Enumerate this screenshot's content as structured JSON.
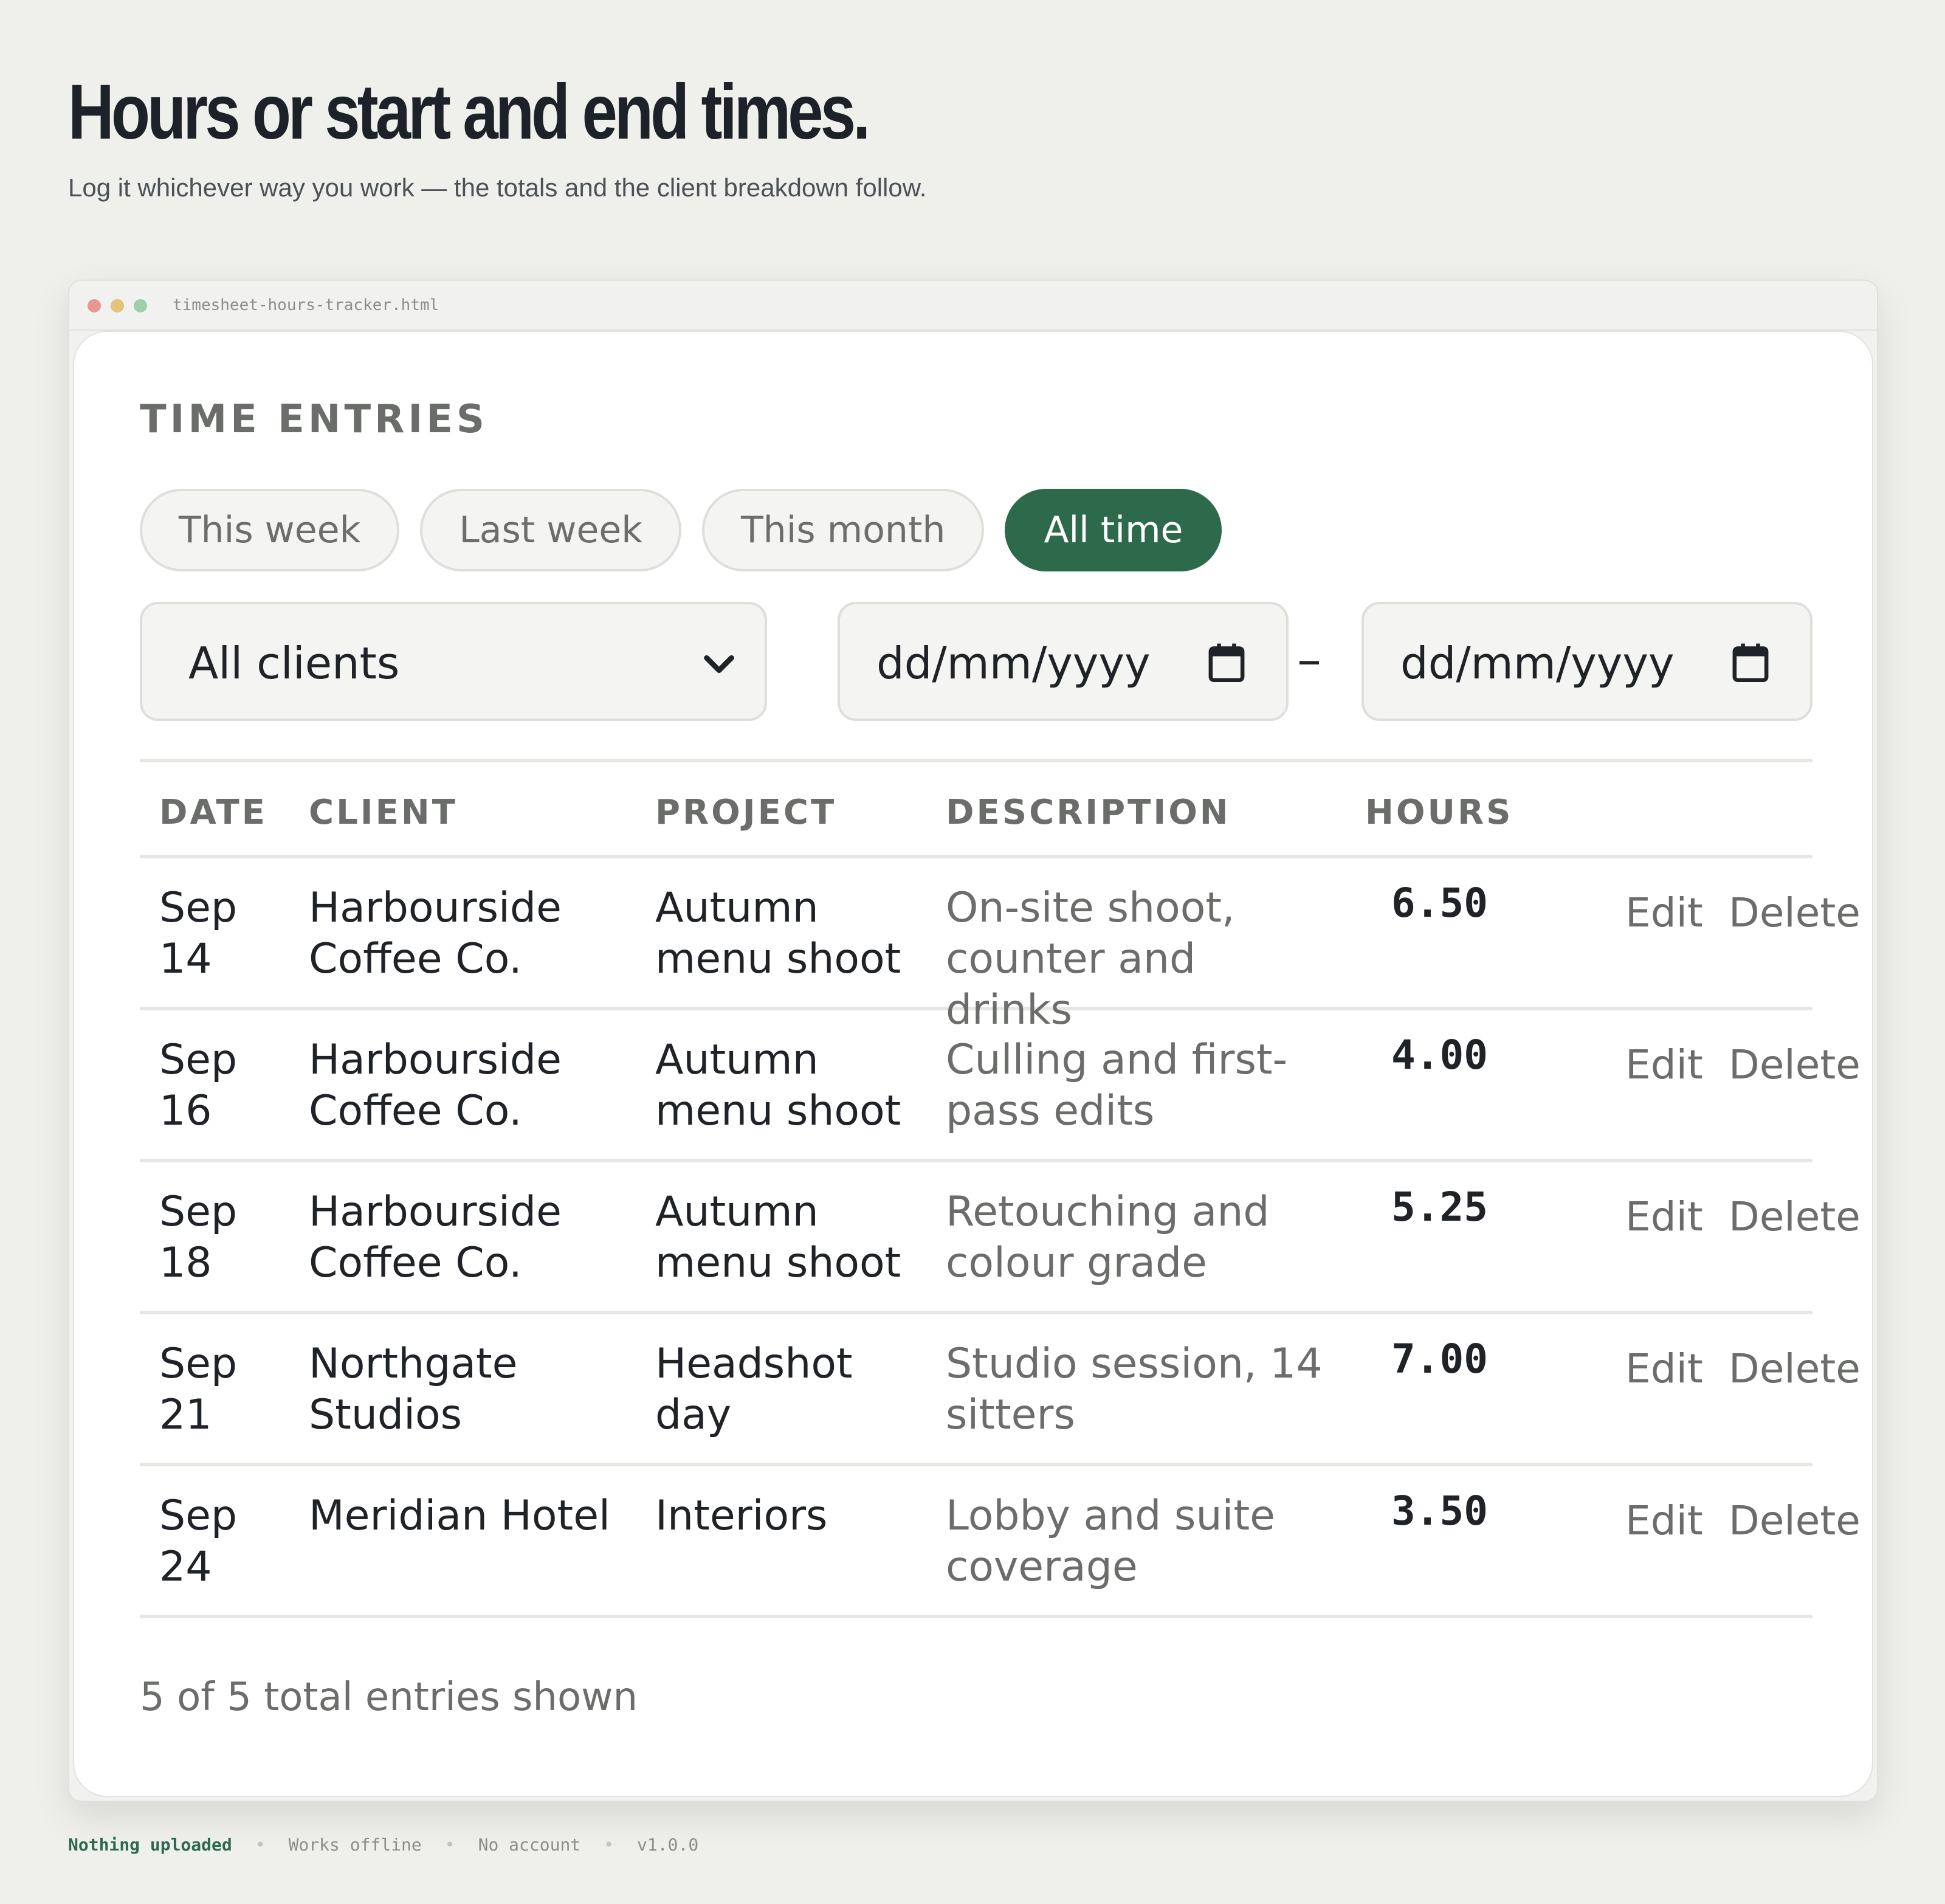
{
  "hero": {
    "title": "Hours or start and end times.",
    "subtitle": "Log it whichever way you work — the totals and the client breakdown follow."
  },
  "window": {
    "filename": "timesheet-hours-tracker.html"
  },
  "entries": {
    "section_title": "TIME ENTRIES",
    "periods": [
      {
        "label": "This week",
        "active": false
      },
      {
        "label": "Last week",
        "active": false
      },
      {
        "label": "This month",
        "active": false
      },
      {
        "label": "All time",
        "active": true
      }
    ],
    "client_filter": {
      "value": "All clients"
    },
    "date_from": {
      "placeholder": "dd/mm/yyyy"
    },
    "date_separator": "–",
    "date_to": {
      "placeholder": "dd/mm/yyyy"
    },
    "columns": {
      "date": "DATE",
      "client": "CLIENT",
      "project": "PROJECT",
      "description": "DESCRIPTION",
      "hours": "HOURS"
    },
    "rows": [
      {
        "date": "Sep 14",
        "client": "Harbourside Coffee Co.",
        "project": "Autumn menu shoot",
        "description": "On-site shoot, counter and drinks",
        "hours": "6.50",
        "edit": "Edit",
        "delete": "Delete"
      },
      {
        "date": "Sep 16",
        "client": "Harbourside Coffee Co.",
        "project": "Autumn menu shoot",
        "description": "Culling and first-pass edits",
        "hours": "4.00",
        "edit": "Edit",
        "delete": "Delete"
      },
      {
        "date": "Sep 18",
        "client": "Harbourside Coffee Co.",
        "project": "Autumn menu shoot",
        "description": "Retouching and colour grade",
        "hours": "5.25",
        "edit": "Edit",
        "delete": "Delete"
      },
      {
        "date": "Sep 21",
        "client": "Northgate Studios",
        "project": "Headshot day",
        "description": "Studio session, 14 sitters",
        "hours": "7.00",
        "edit": "Edit",
        "delete": "Delete"
      },
      {
        "date": "Sep 24",
        "client": "Meridian Hotel",
        "project": "Interiors",
        "description": "Lobby and suite coverage",
        "hours": "3.50",
        "edit": "Edit",
        "delete": "Delete"
      }
    ],
    "count_text": "5 of 5 total entries shown"
  },
  "footer": {
    "items": [
      "Nothing uploaded",
      "Works offline",
      "No account",
      "v1.0.0"
    ]
  },
  "colors": {
    "accent": "#2d6a4b",
    "background": "#eff0ec"
  }
}
